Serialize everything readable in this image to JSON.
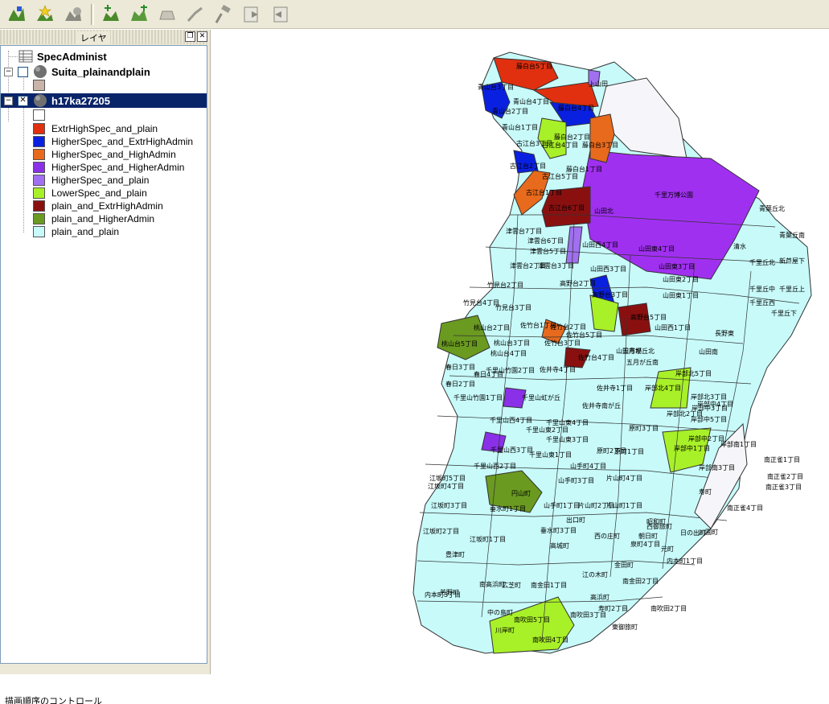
{
  "toolbar": {
    "buttons": [
      {
        "name": "add-layer-button",
        "icon": "add-layer-icon"
      },
      {
        "name": "add-favorite-button",
        "icon": "star-layer-icon"
      },
      {
        "name": "remove-layer-button",
        "icon": "remove-layer-icon"
      },
      {
        "name": "add-feature-button",
        "icon": "add-feature-icon"
      },
      {
        "name": "add-shape-button",
        "icon": "add-shape-icon"
      },
      {
        "name": "edit-shape-button",
        "icon": "edit-shape-icon"
      },
      {
        "name": "move-vertex-button",
        "icon": "move-vertex-icon"
      },
      {
        "name": "tools-button",
        "icon": "hammer-icon"
      },
      {
        "name": "export-button",
        "icon": "export-icon"
      },
      {
        "name": "import-button",
        "icon": "import-icon"
      }
    ]
  },
  "layer_panel": {
    "title": "レイヤ",
    "layers": [
      {
        "name": "SpecAdminist",
        "visible": null
      },
      {
        "name": "Suita_plainandplain",
        "visible": false
      },
      {
        "name": "h17ka27205",
        "visible": true,
        "selected": true
      }
    ],
    "legend": [
      {
        "label": "ExtrHighSpec_and_plain",
        "color": "#e03010"
      },
      {
        "label": "HigherSpec_and_ExtrHighAdmin",
        "color": "#0a20e0"
      },
      {
        "label": "HigherSpec_and_HighAdmin",
        "color": "#e86a1c"
      },
      {
        "label": "HigherSpec_and_HigherAdmin",
        "color": "#8a30e8"
      },
      {
        "label": "HigherSpec_and_plain",
        "color": "#a070f0"
      },
      {
        "label": "LowerSpec_and_plain",
        "color": "#a8f028"
      },
      {
        "label": "plain_and_ExtrHighAdmin",
        "color": "#8a1010"
      },
      {
        "label": "plain_and_HigherAdmin",
        "color": "#6a9a20"
      },
      {
        "label": "plain_and_plain",
        "color": "#c8fafa"
      }
    ],
    "suita_swatch_color": "#c8b4a8",
    "status_text": "描画順序のコントロール"
  },
  "map": {
    "labels": [
      "藤白台5丁目",
      "青山台3丁目",
      "青山台4丁目",
      "上山田",
      "藤白台4丁目",
      "青山台2丁目",
      "青山台1丁目",
      "藤白台2丁目",
      "古江台3丁目",
      "古江台4丁目",
      "藤白台3丁目",
      "古江台2丁目",
      "古江台5丁目",
      "藤白台1丁目",
      "古江台1丁目",
      "古江台6丁目",
      "千里万博公園",
      "山田北",
      "青葉丘北",
      "青葉丘南",
      "津雲台7丁目",
      "津雲台6丁目",
      "山田西4丁目",
      "津雲台5丁目",
      "山田東4丁目",
      "清水",
      "千里丘北",
      "新芦屋下",
      "津雲台2丁目",
      "津雲台3丁目",
      "山田西3丁目",
      "山田東3丁目",
      "山田東2丁目",
      "竹見台2丁目",
      "高野台2丁目",
      "千里丘中",
      "千里丘上",
      "山田西1丁目",
      "山田東1丁目",
      "竹見台4丁目",
      "竹見台3丁目",
      "高野台3丁目",
      "千里丘西",
      "佐竹台1丁目",
      "佐竹台2丁目",
      "佐竹台5丁目",
      "高野台5丁目",
      "山田南",
      "長野東",
      "千里丘下",
      "桃山台2丁目",
      "佐竹台3丁目",
      "桃山台5丁目",
      "桃山台3丁目",
      "佐竹台4丁目",
      "山田市場",
      "桃山台4丁目",
      "五月が丘北",
      "春日3丁目",
      "千里山竹園2丁目",
      "佐井寺4丁目",
      "五月が丘南",
      "春日4丁目",
      "岸部北5丁目",
      "春日2丁目",
      "千里山虹が丘",
      "佐井寺1丁目",
      "岸部北4丁目",
      "千里山竹園1丁目",
      "佐井寺南が丘",
      "岸部北3丁目",
      "千里山東4丁目",
      "岸部北2丁目",
      "岸部中5丁目",
      "千里山西4丁目",
      "千里山東2丁目",
      "岸部中4丁目",
      "千里山東3丁目",
      "原町3丁目",
      "岸部中3丁目",
      "千里山西3丁目",
      "千里山東1丁目",
      "原町2丁目",
      "原町1丁目",
      "岸部中2丁目",
      "千里山西2丁目",
      "山手町4丁目",
      "岸部南1丁目",
      "岸部中1丁目",
      "江坂町5丁目",
      "山手町3丁目",
      "片山町4丁目",
      "岸部南3丁目",
      "南正雀1丁目",
      "江坂町4丁目",
      "円山町",
      "片山町2丁目",
      "南正雀2丁目",
      "南正雀3丁目",
      "江坂町3丁目",
      "垂水町1丁目",
      "山手町1丁目",
      "片山町1丁目",
      "寿町",
      "南正雀4丁目",
      "出口町",
      "昭和町",
      "江坂町2丁目",
      "豊津町",
      "西の庄町",
      "朝日町",
      "日の出町",
      "川園町",
      "江坂町1丁目",
      "垂水町3丁目",
      "泉町4丁目",
      "元町",
      "高城町",
      "金田町",
      "内本町1丁目",
      "南高浜町",
      "広芝町",
      "南金田1丁目",
      "南金田2丁目",
      "内本町3丁目",
      "芳野町",
      "江の木町",
      "高浜町",
      "寿町2丁目",
      "中の島町",
      "南吹田5丁目",
      "南吹田3丁目",
      "川岸町",
      "南吹田4丁目",
      "南吹田2丁目",
      "東御旅町",
      "西御旅町"
    ]
  }
}
